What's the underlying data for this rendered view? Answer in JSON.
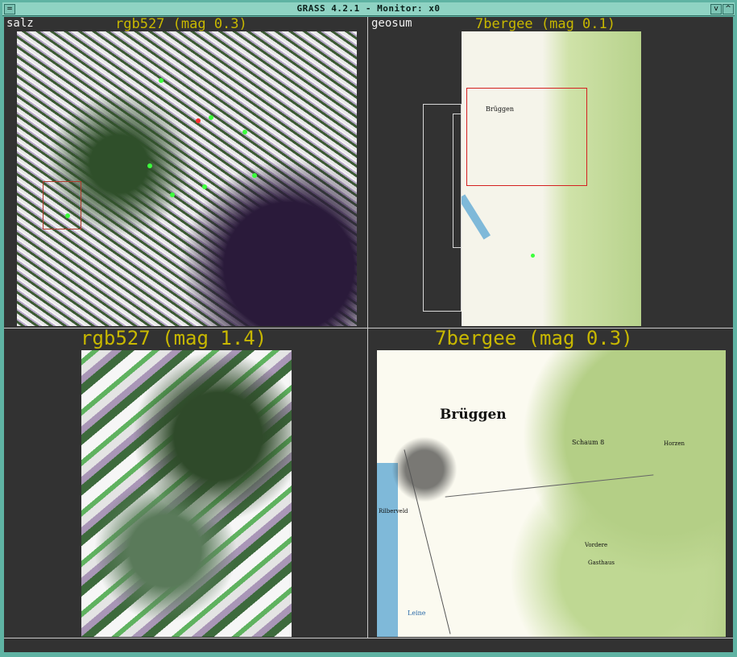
{
  "window": {
    "title": "GRASS 4.2.1 - Monitor: x0",
    "buttons": {
      "menu": "=",
      "minimize": "v",
      "maximize": "^"
    }
  },
  "frames": {
    "top_left": {
      "label": "salz",
      "map_title": "rgb527 (mag 0.3)"
    },
    "top_right": {
      "label": "geosum",
      "map_title": "7bergee (mag 0.1)",
      "place": "Brüggen"
    },
    "bottom_left": {
      "map_title": "rgb527 (mag 1.4)"
    },
    "bottom_right": {
      "map_title": "7bergee (mag 0.3)",
      "place": "Brüggen",
      "labels": [
        "Schaum 8",
        "Rilberveld",
        "Leine",
        "Horzen",
        "Vordere",
        "Gasthaus"
      ]
    }
  },
  "colors": {
    "map_title": "#c8b800",
    "frame_label": "#f0f0f0",
    "background": "#323232",
    "region_box": "#d42020",
    "window_frame": "#5fb3a3"
  }
}
